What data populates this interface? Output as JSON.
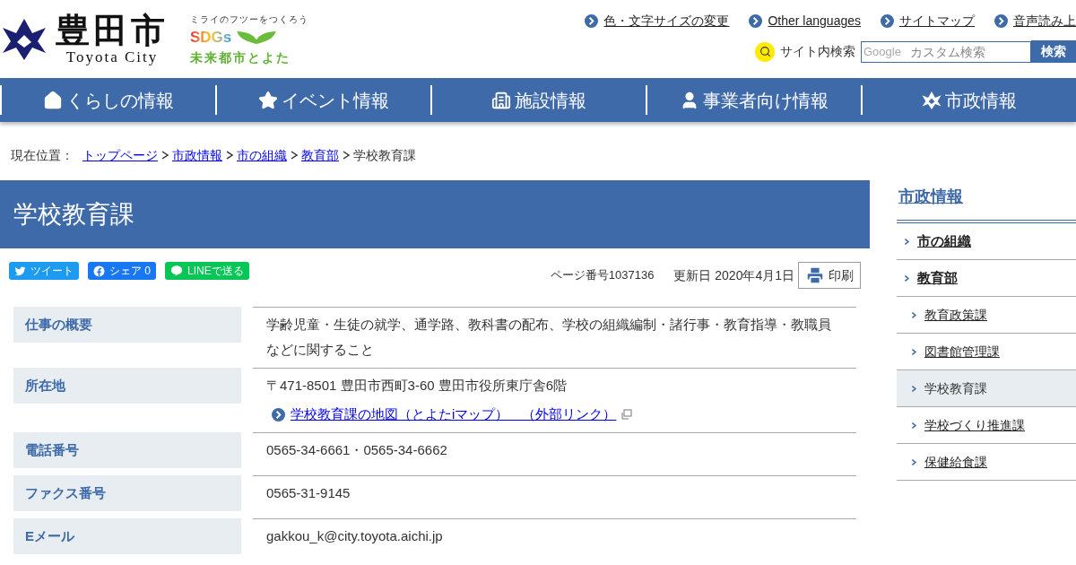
{
  "header": {
    "logo_title": "豊田市",
    "logo_subtitle": "Toyota City",
    "sdgs_tagline": "ミライのフツーをつくろう",
    "sdgs_mark": "SDGs",
    "sdgs_caption": "未来都市とよた",
    "utility_links": [
      "色・文字サイズの変更",
      "Other languages",
      "サイトマップ",
      "音声読み上"
    ],
    "search": {
      "label": "サイト内検索",
      "placeholder": "カスタム検索",
      "brand": "Google",
      "button": "検索"
    }
  },
  "nav": [
    {
      "label": "くらしの情報",
      "kind": "home"
    },
    {
      "label": "イベント情報",
      "kind": "star"
    },
    {
      "label": "施設情報",
      "kind": "building"
    },
    {
      "label": "事業者向け情報",
      "kind": "person"
    },
    {
      "label": "市政情報",
      "kind": "emblem"
    }
  ],
  "breadcrumb": {
    "label": "現在位置：",
    "links": [
      "トップページ",
      "市政情報",
      "市の組織",
      "教育部"
    ],
    "current": "学校教育課"
  },
  "page": {
    "title": "学校教育課",
    "share": [
      {
        "kind": "twitter",
        "label": "ツイート"
      },
      {
        "kind": "facebook",
        "label": "シェア 0"
      },
      {
        "kind": "line",
        "label": "LINEで送る"
      }
    ],
    "page_number": "ページ番号1037136",
    "updated": "更新日 2020年4月1日",
    "print": "印刷",
    "rows": [
      {
        "label": "仕事の概要",
        "values": [
          {
            "kind": "text",
            "text": "学齢児童・生徒の就学、通学路、教科書の配布、学校の組織編制・諸行事・教育指導・教職員などに関すること"
          }
        ]
      },
      {
        "label": "所在地",
        "values": [
          {
            "kind": "text",
            "text": "〒471-8501 豊田市西町3-60 豊田市役所東庁舎6階"
          },
          {
            "kind": "link",
            "text": "学校教育課の地図（とよたiマップ）　（外部リンク）"
          }
        ]
      },
      {
        "label": "電話番号",
        "values": [
          {
            "kind": "text",
            "text": "0565-34-6661・0565-34-6662"
          }
        ]
      },
      {
        "label": "ファクス番号",
        "values": [
          {
            "kind": "text",
            "text": "0565-31-9145"
          }
        ]
      },
      {
        "label": "Eメール",
        "values": [
          {
            "kind": "text",
            "text": "gakkou_k@city.toyota.aichi.jp"
          }
        ]
      }
    ]
  },
  "sidebar": {
    "title": "市政情報",
    "items": [
      {
        "label": "市の組織",
        "selected": false
      },
      {
        "label": "教育部",
        "selected": false,
        "children": [
          {
            "label": "教育政策課",
            "selected": false
          },
          {
            "label": "図書館管理課",
            "selected": false
          },
          {
            "label": "学校教育課",
            "selected": true
          },
          {
            "label": "学校づくり推進課",
            "selected": false
          },
          {
            "label": "保健給食課",
            "selected": false
          }
        ]
      }
    ]
  }
}
